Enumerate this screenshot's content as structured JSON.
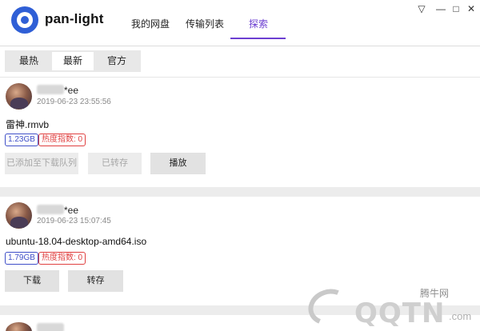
{
  "app": {
    "brand": "pan-light"
  },
  "tabs": [
    {
      "label": "我的网盘",
      "active": false
    },
    {
      "label": "传输列表",
      "active": false
    },
    {
      "label": "探索",
      "active": true
    }
  ],
  "window_controls": {
    "menu": "▽",
    "minimize": "—",
    "maximize": "□",
    "close": "✕"
  },
  "filters": [
    {
      "label": "最热",
      "active": false
    },
    {
      "label": "最新",
      "active": true
    },
    {
      "label": "官方",
      "active": false
    }
  ],
  "posts": [
    {
      "user_suffix": "*ee",
      "time": "2019-06-23 23:55:56",
      "file": "雷神.rmvb",
      "size": "1.23GB",
      "heat": "热度指数: 0",
      "actions": [
        {
          "label": "已添加至下载队列",
          "enabled": false
        },
        {
          "label": "已转存",
          "enabled": false
        },
        {
          "label": "播放",
          "enabled": true
        }
      ]
    },
    {
      "user_suffix": "*ee",
      "time": "2019-06-23 15:07:45",
      "file": "ubuntu-18.04-desktop-amd64.iso",
      "size": "1.79GB",
      "heat": "热度指数: 0",
      "actions": [
        {
          "label": "下载",
          "enabled": true
        },
        {
          "label": "转存",
          "enabled": true
        }
      ]
    }
  ],
  "watermark": {
    "text": "QQTN",
    "com": ".com",
    "cn": "腾牛网"
  },
  "colors": {
    "accent": "#6c3fd1",
    "brand_blue": "#2f5fd6",
    "size_badge": "#3f4fc8",
    "heat_badge": "#e04040"
  }
}
